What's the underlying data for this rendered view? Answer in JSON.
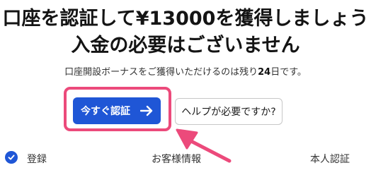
{
  "headline": {
    "line1": "口座を認証して¥13000を獲得しましょう",
    "line2": "入金の必要はございません"
  },
  "subtext": {
    "before": "口座開設ボーナスをご獲得いただけるのは残り",
    "days": "24",
    "after": "日です。"
  },
  "buttons": {
    "verify_now": "今すぐ認証",
    "help": "ヘルプが必要ですか?"
  },
  "steps": [
    {
      "label": "登録",
      "status": "completed"
    },
    {
      "label": "お客様情報",
      "status": "pending"
    },
    {
      "label": "本人認証",
      "status": "pending"
    }
  ],
  "colors": {
    "primary": "#1f56d6",
    "highlight": "#ec4a7b",
    "text": "#141414"
  },
  "icons": {
    "cta": "arrow-right-icon",
    "pointer": "pointer-arrow-icon",
    "step_done": "check-circle-icon"
  }
}
